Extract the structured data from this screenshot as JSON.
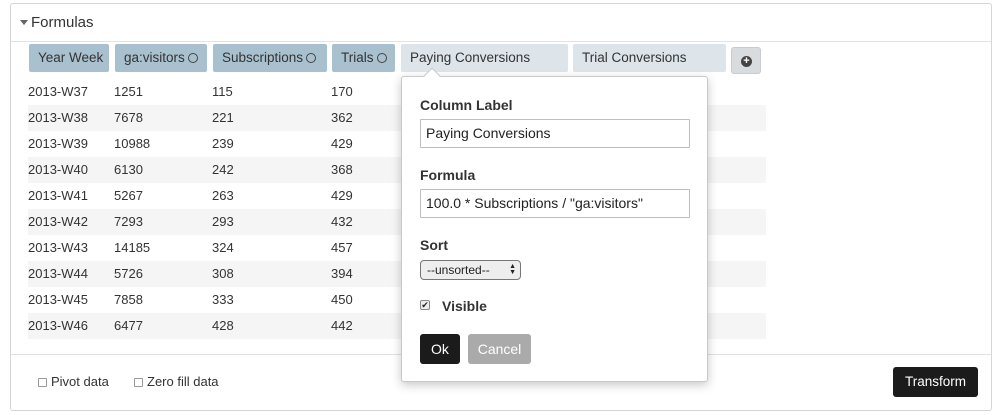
{
  "panel": {
    "title": "Formulas"
  },
  "columns": [
    {
      "label": "Year Week",
      "type": "formula",
      "has_menu": false
    },
    {
      "label": "ga:visitors",
      "type": "formula",
      "has_menu": true
    },
    {
      "label": "Subscriptions",
      "type": "formula",
      "has_menu": true
    },
    {
      "label": "Trials",
      "type": "formula",
      "has_menu": true
    },
    {
      "label": "Paying Conversions",
      "type": "calc",
      "has_menu": false
    },
    {
      "label": "Trial Conversions",
      "type": "calc",
      "has_menu": false
    }
  ],
  "rows": [
    [
      "2013-W37",
      "1251",
      "115",
      "170"
    ],
    [
      "2013-W38",
      "7678",
      "221",
      "362"
    ],
    [
      "2013-W39",
      "10988",
      "239",
      "429"
    ],
    [
      "2013-W40",
      "6130",
      "242",
      "368"
    ],
    [
      "2013-W41",
      "5267",
      "263",
      "429"
    ],
    [
      "2013-W42",
      "7293",
      "293",
      "432"
    ],
    [
      "2013-W43",
      "14185",
      "324",
      "457"
    ],
    [
      "2013-W44",
      "5726",
      "308",
      "394"
    ],
    [
      "2013-W45",
      "7858",
      "333",
      "450"
    ],
    [
      "2013-W46",
      "6477",
      "428",
      "442"
    ]
  ],
  "footer": {
    "pivot_label": "Pivot data",
    "zero_fill_label": "Zero fill data",
    "transform_label": "Transform"
  },
  "popover": {
    "column_label_heading": "Column Label",
    "column_label_value": "Paying Conversions",
    "formula_heading": "Formula",
    "formula_value": "100.0 * Subscriptions / \"ga:visitors\"",
    "sort_heading": "Sort",
    "sort_value": "--unsorted--",
    "visible_label": "Visible",
    "visible_checked": true,
    "ok_label": "Ok",
    "cancel_label": "Cancel"
  },
  "icons": {
    "caret": "caret-down-icon",
    "add_column": "plus-circle-icon",
    "column_menu": "circle-icon"
  },
  "colors": {
    "formula_header": "#a9c0cf",
    "calc_header": "#dde4ea",
    "primary_button": "#1b1b1b",
    "disabled_button": "#aaaaaa"
  }
}
